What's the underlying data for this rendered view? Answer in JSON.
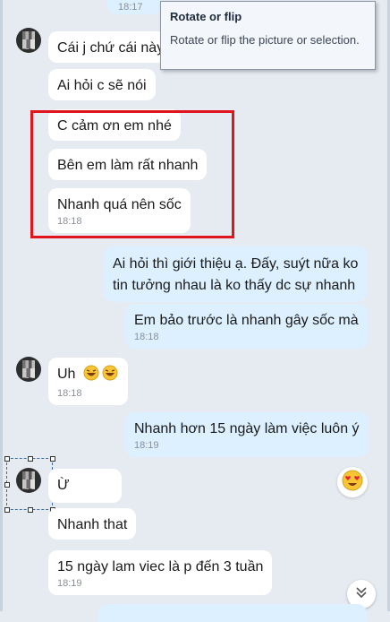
{
  "top_timestamp": "18:17",
  "tooltip": {
    "title": "Rotate or flip",
    "body": "Rotate or flip the picture or selection."
  },
  "messages": [
    {
      "text": "Cái j chứ cái này",
      "time": ""
    },
    {
      "text": "Ai hỏi c sẽ nói",
      "time": ""
    },
    {
      "text": "C cảm ơn em nhé",
      "time": ""
    },
    {
      "text": "Bên em làm rất nhanh",
      "time": ""
    },
    {
      "text": "Nhanh quá nên sốc",
      "time": "18:18"
    },
    {
      "text": "Ai hỏi thì giới thiệu ạ. Đấy, suýt nữa ko",
      "text2": "tin tưởng nhau là ko thấy dc sự nhanh",
      "time": ""
    },
    {
      "text": "Em bảo trước là nhanh gây sốc mà",
      "time": "18:18"
    },
    {
      "text": "Uh",
      "time": "18:18"
    },
    {
      "text": "Nhanh hơn 15 ngày làm việc luôn ý",
      "time": "18:19"
    },
    {
      "text": "Ừ",
      "time": ""
    },
    {
      "text": "Nhanh that",
      "time": ""
    },
    {
      "text": "15 ngày lam viec là p đến 3 tuần",
      "time": "18:19"
    }
  ],
  "icons": {
    "reaction": "heart-eyes-emoji",
    "scroll": "chevron-double-down-icon",
    "laugh": "grinning-sweat-emoji"
  },
  "colors": {
    "background": "#e6ebf2",
    "incoming_bubble": "#ffffff",
    "outgoing_bubble": "#dcf0ff",
    "highlight": "#e0141c",
    "timestamp": "#8a8f96"
  }
}
